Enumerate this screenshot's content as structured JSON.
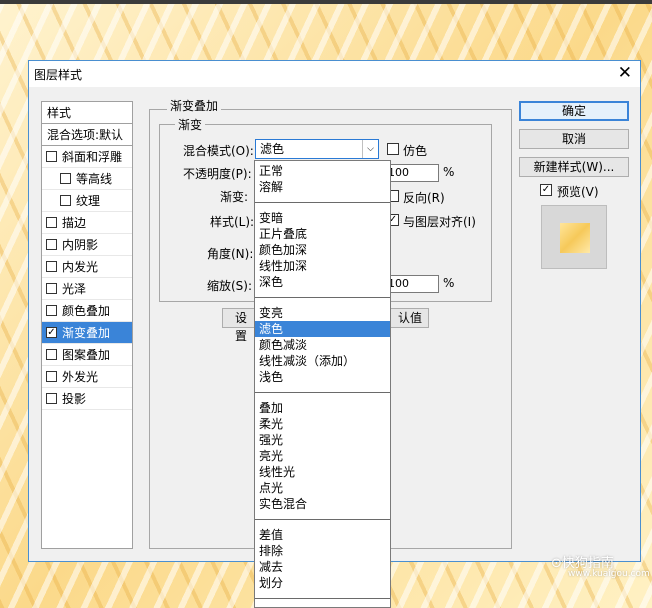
{
  "window": {
    "title": "图层样式",
    "close_glyph": "✕"
  },
  "sidebar": {
    "header": "样式",
    "blend_options": "混合选项:默认",
    "items": [
      {
        "label": "斜面和浮雕",
        "checked": false,
        "indent": false
      },
      {
        "label": "等高线",
        "checked": false,
        "indent": true
      },
      {
        "label": "纹理",
        "checked": false,
        "indent": true
      },
      {
        "label": "描边",
        "checked": false,
        "indent": false
      },
      {
        "label": "内阴影",
        "checked": false,
        "indent": false
      },
      {
        "label": "内发光",
        "checked": false,
        "indent": false
      },
      {
        "label": "光泽",
        "checked": false,
        "indent": false
      },
      {
        "label": "颜色叠加",
        "checked": false,
        "indent": false
      },
      {
        "label": "渐变叠加",
        "checked": true,
        "indent": false,
        "active": true
      },
      {
        "label": "图案叠加",
        "checked": false,
        "indent": false
      },
      {
        "label": "外发光",
        "checked": false,
        "indent": false
      },
      {
        "label": "投影",
        "checked": false,
        "indent": false
      }
    ]
  },
  "panel": {
    "group_title": "渐变叠加",
    "sub_title": "渐变",
    "blend_mode_label": "混合模式(O):",
    "blend_mode_value": "滤色",
    "dither_label": "仿色",
    "opacity_label": "不透明度(P):",
    "opacity_value": "100",
    "percent": "%",
    "gradient_label": "渐变:",
    "reverse_label": "反向(R)",
    "style_label": "样式(L):",
    "align_label": "与图层对齐(I)",
    "angle_label": "角度(N):",
    "scale_label": "缩放(S):",
    "scale_value": "100",
    "set_default_partial": "设置",
    "reset_default_partial": "认值"
  },
  "buttons": {
    "ok": "确定",
    "cancel": "取消",
    "new_style": "新建样式(W)...",
    "preview_label": "预览(V)",
    "preview_checked": true
  },
  "blend_dropdown": {
    "groups": [
      [
        "正常",
        "溶解"
      ],
      [
        "变暗",
        "正片叠底",
        "颜色加深",
        "线性加深",
        "深色"
      ],
      [
        "变亮",
        "滤色",
        "颜色减淡",
        "线性减淡（添加）",
        "浅色"
      ],
      [
        "叠加",
        "柔光",
        "强光",
        "亮光",
        "线性光",
        "点光",
        "实色混合"
      ],
      [
        "差值",
        "排除",
        "减去",
        "划分"
      ]
    ],
    "selected": "滤色"
  },
  "watermark": {
    "text": "⊙快狗指南",
    "sub": "www.kuaigou.com"
  },
  "colors": {
    "accent": "#3a84d8",
    "dialog_bg": "#f0f0f0",
    "border": "#4a8fd0"
  }
}
